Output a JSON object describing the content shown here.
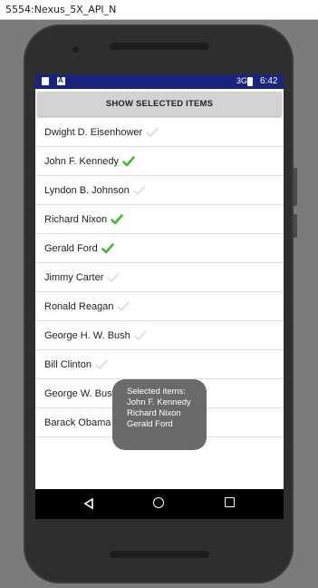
{
  "window": {
    "title": "5554:Nexus_5X_API_N"
  },
  "status_bar": {
    "time": "6:42",
    "signal_label": "3G"
  },
  "action_button": {
    "label": "SHOW SELECTED ITEMS"
  },
  "list": {
    "items": [
      {
        "label": "Dwight D. Eisenhower",
        "selected": false
      },
      {
        "label": "John F. Kennedy",
        "selected": true
      },
      {
        "label": "Lyndon B. Johnson",
        "selected": false
      },
      {
        "label": "Richard Nixon",
        "selected": true
      },
      {
        "label": "Gerald Ford",
        "selected": true
      },
      {
        "label": "Jimmy Carter",
        "selected": false
      },
      {
        "label": "Ronald Reagan",
        "selected": false
      },
      {
        "label": "George H. W. Bush",
        "selected": false
      },
      {
        "label": "Bill Clinton",
        "selected": false
      },
      {
        "label": "George W. Bush",
        "selected": false
      },
      {
        "label": "Barack Obama",
        "selected": false
      }
    ]
  },
  "toast": {
    "heading": "Selected items:",
    "lines": [
      "John F. Kennedy",
      "Richard Nixon",
      "Gerald Ford"
    ]
  },
  "colors": {
    "check_selected": "#3dbb2c",
    "check_unselected": "#e2e2e2",
    "status_bar": "#1a237e",
    "button_bg": "#d3d3d3"
  },
  "icons": {
    "check": "check-icon",
    "back": "back-icon",
    "home": "home-icon",
    "recent": "recent-apps-icon"
  }
}
